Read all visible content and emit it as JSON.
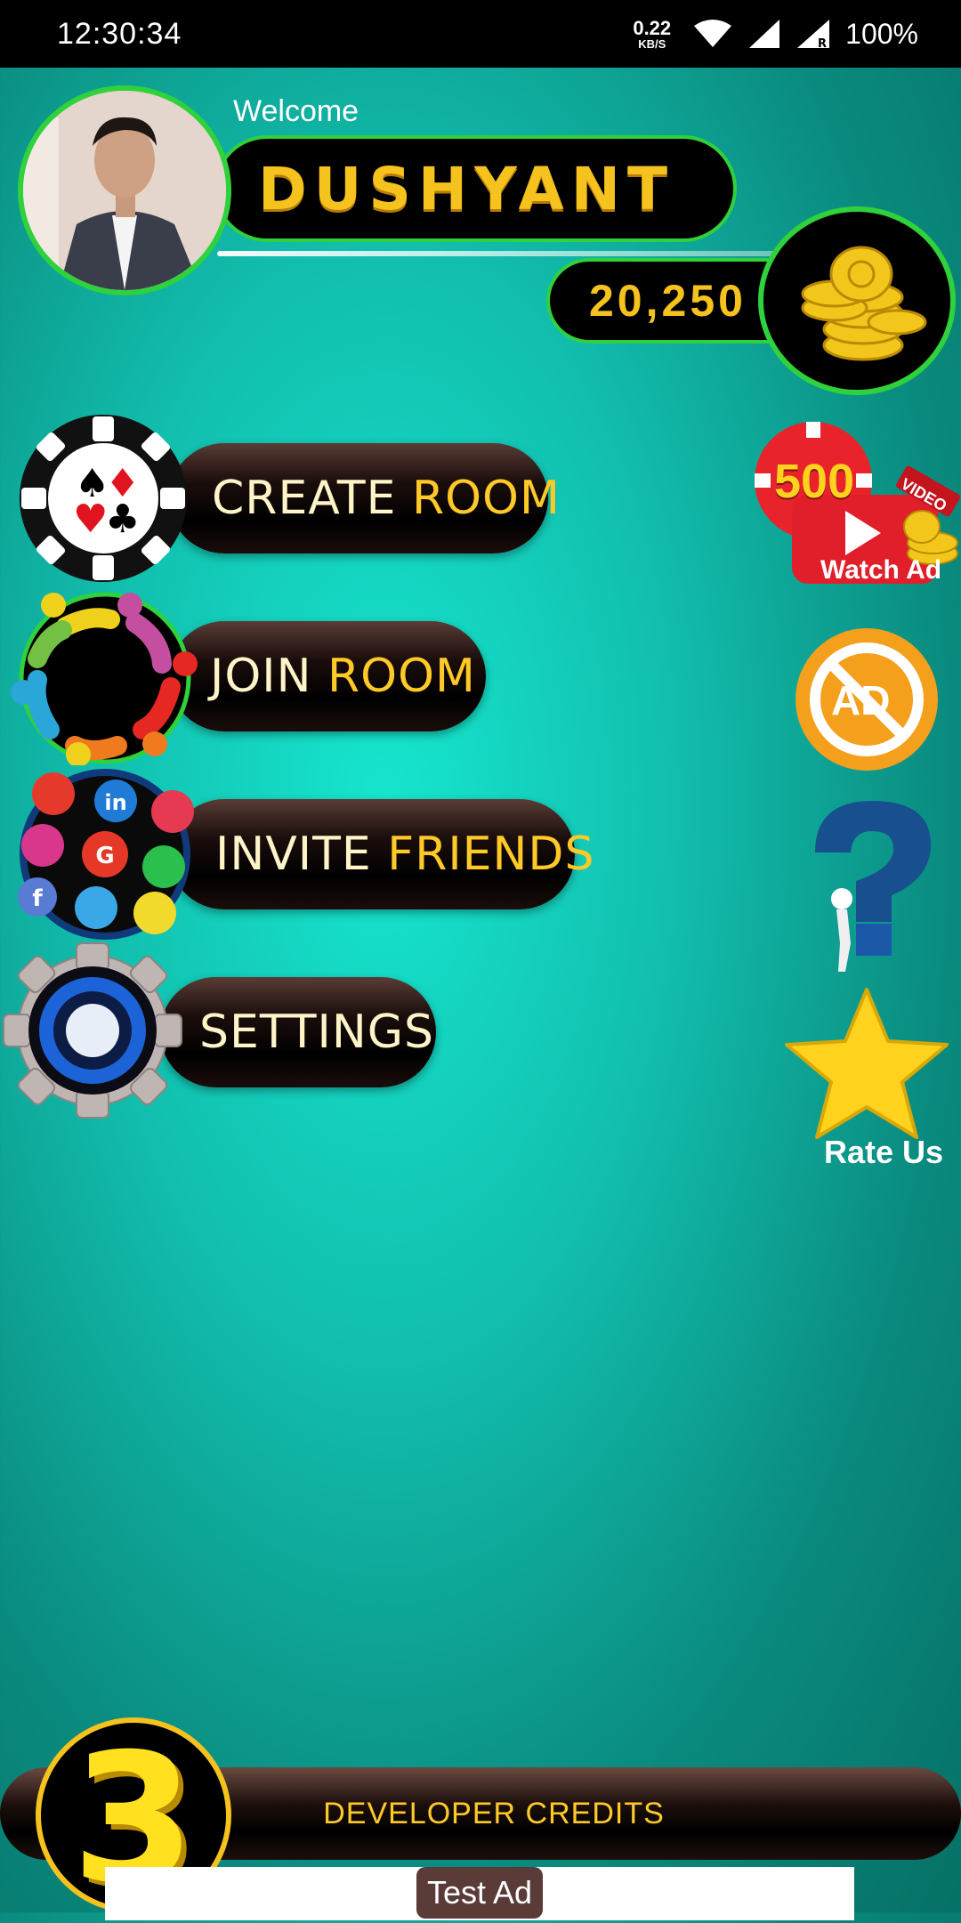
{
  "status_bar": {
    "time": "12:30:34",
    "net_speed_value": "0.22",
    "net_speed_unit": "KB/S",
    "battery": "100%",
    "icons": [
      "data-arrows-icon",
      "wifi-icon",
      "signal-icon",
      "roaming-signal-icon"
    ]
  },
  "profile": {
    "welcome": "Welcome",
    "name": "DUSHYANT",
    "coins": "20,250"
  },
  "menu": {
    "create_room": {
      "word1": "CREATE",
      "word2": "ROOM"
    },
    "join_room": {
      "word1": "JOIN",
      "word2": "ROOM"
    },
    "invite_friends": {
      "word1": "INVITE",
      "word2": "FRIENDS"
    },
    "settings": {
      "label": "SETTINGS"
    }
  },
  "side": {
    "watch_ad_amount": "500",
    "watch_ad_tag": "VIDEO",
    "watch_ad_label": "Watch Ad",
    "remove_ads_badge": "AD",
    "rate_us_label": "Rate Us"
  },
  "footer": {
    "badge_number": "3",
    "credits_label": "DEVELOPER CREDITS",
    "test_ad": "Test Ad"
  },
  "colors": {
    "accent_gold": "#f6c21e",
    "ring_green": "#2fd13c",
    "background_teal": "#12bfae"
  }
}
